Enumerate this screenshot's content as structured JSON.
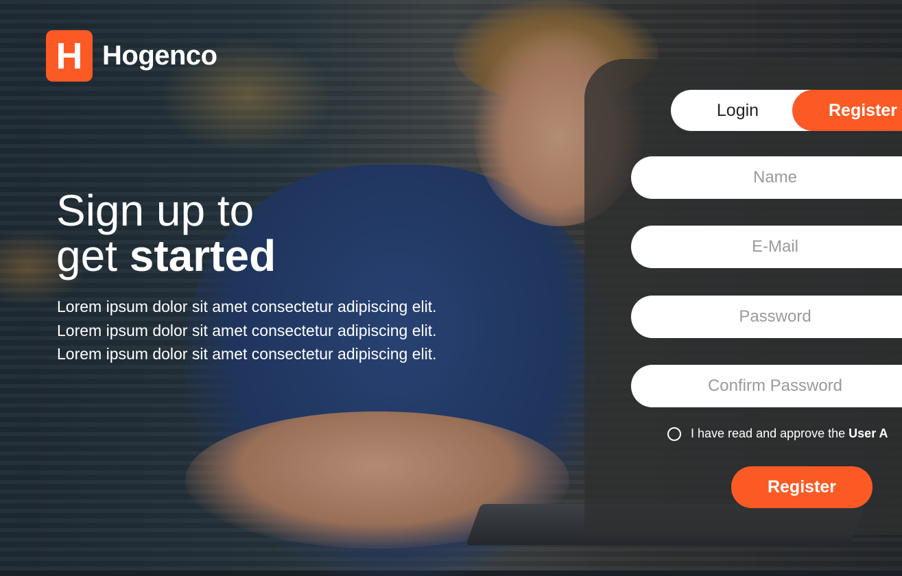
{
  "brand": {
    "logo_letter": "H",
    "name": "Hogenco",
    "accent_color": "#fb5a25"
  },
  "hero": {
    "title_line1": "Sign up to",
    "title_line2_plain": "get ",
    "title_line2_bold": "started",
    "description": "Lorem ipsum dolor sit amet consectetur adipiscing elit. Lorem ipsum dolor sit amet consectetur adipiscing elit. Lorem ipsum dolor sit amet consectetur adipiscing elit."
  },
  "auth_tabs": {
    "login_label": "Login",
    "register_label": "Register",
    "active": "Register"
  },
  "form": {
    "name_placeholder": "Name",
    "email_placeholder": "E-Mail",
    "password_placeholder": "Password",
    "confirm_password_placeholder": "Confirm Password",
    "agreement_text": "I have read and approve the",
    "agreement_link": "User A",
    "agreement_checked": false,
    "submit_label": "Register"
  },
  "icons": {
    "checkbox": "radio-circle-icon",
    "logo": "h-logo-icon"
  }
}
